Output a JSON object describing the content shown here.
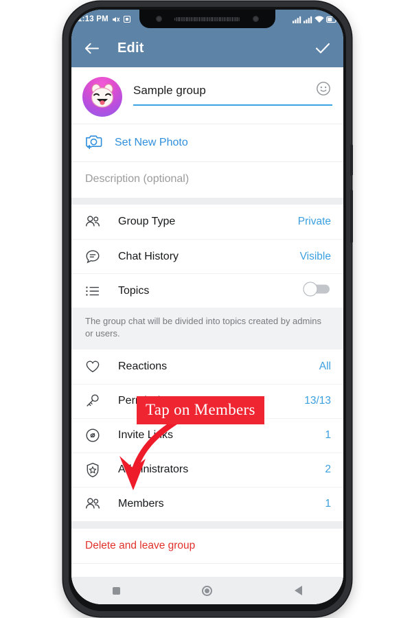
{
  "status_bar": {
    "time": "1:13 PM",
    "icons_left": [
      "mute-icon",
      "screenshot-icon"
    ],
    "icons_right": [
      "signal-sim1-icon",
      "signal-sim2-icon",
      "wifi-icon",
      "battery-icon"
    ]
  },
  "appbar": {
    "back_icon": "back-arrow-icon",
    "title": "Edit",
    "confirm_icon": "checkmark-icon",
    "background": "#5d83a7"
  },
  "group": {
    "avatar_label": "group-photo",
    "name_value": "Sample group",
    "emoji_icon": "smiley-icon",
    "set_photo_label": "Set New Photo",
    "set_photo_icon": "camera-add-icon",
    "description_placeholder": "Description (optional)"
  },
  "settings_primary": [
    {
      "icon": "people-icon",
      "label": "Group Type",
      "value": "Private",
      "type": "value"
    },
    {
      "icon": "chat-bubble-icon",
      "label": "Chat History",
      "value": "Visible",
      "type": "value"
    },
    {
      "icon": "list-icon",
      "label": "Topics",
      "value": "",
      "type": "toggle",
      "toggle_on": false
    }
  ],
  "topics_hint": "The group chat will be divided into topics created by admins or users.",
  "settings_secondary": [
    {
      "icon": "heart-icon",
      "label": "Reactions",
      "value": "All"
    },
    {
      "icon": "key-icon",
      "label": "Permissions",
      "value": "13/13"
    },
    {
      "icon": "link-icon",
      "label": "Invite Links",
      "value": "1"
    },
    {
      "icon": "shield-star-icon",
      "label": "Administrators",
      "value": "2"
    },
    {
      "icon": "people-icon",
      "label": "Members",
      "value": "1"
    }
  ],
  "danger": {
    "label": "Delete and leave group",
    "color": "#e2312b"
  },
  "annotation": {
    "text": "Tap on Members",
    "color": "#ef2532",
    "arrow": "curved-down-arrow"
  },
  "nav_bar": {
    "recents": "recents-square-icon",
    "home": "home-circle-icon",
    "back": "back-triangle-icon"
  },
  "colors": {
    "accent_blue": "#3a9fe0",
    "header_blue": "#5d83a7",
    "divider": "#eceef0"
  }
}
